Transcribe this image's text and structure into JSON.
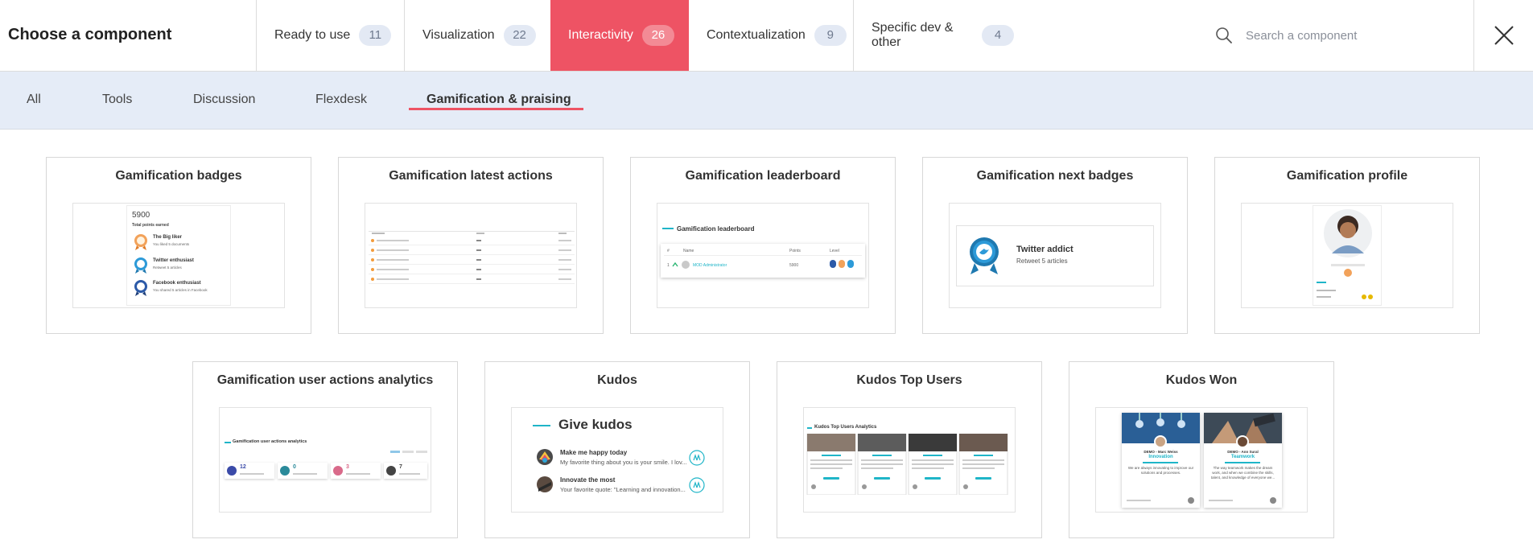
{
  "header": {
    "title": "Choose a component",
    "tabs": [
      {
        "label": "Ready to use",
        "count": "11"
      },
      {
        "label": "Visualization",
        "count": "22"
      },
      {
        "label": "Interactivity",
        "count": "26"
      },
      {
        "label": "Contextualization",
        "count": "9"
      },
      {
        "label": "Specific dev & other",
        "count": "4"
      }
    ],
    "search_placeholder": "Search a component"
  },
  "subnav": {
    "items": [
      "All",
      "Tools",
      "Discussion",
      "Flexdesk",
      "Gamification & praising"
    ]
  },
  "cards": [
    {
      "title": "Gamification badges"
    },
    {
      "title": "Gamification latest actions"
    },
    {
      "title": "Gamification leaderboard"
    },
    {
      "title": "Gamification next badges"
    },
    {
      "title": "Gamification profile"
    },
    {
      "title": "Gamification user actions analytics"
    },
    {
      "title": "Kudos"
    },
    {
      "title": "Kudos Top Users"
    },
    {
      "title": "Kudos Won"
    }
  ],
  "previews": {
    "badges": {
      "points": "5900",
      "points_label": "Total points earned",
      "items": [
        {
          "name": "The Big liker",
          "desc": "You liked 5 documents"
        },
        {
          "name": "Twitter enthusiast",
          "desc": "Retweet 5 articles"
        },
        {
          "name": "Facebook enthusiast",
          "desc": "You shared 5 articles in Facebook"
        }
      ]
    },
    "leaderboard": {
      "title": "Gamification leaderboard",
      "col_rank": "#",
      "col_name": "Name",
      "col_points": "Points",
      "col_level": "Level",
      "row_rank": "1",
      "row_name": "MOD Administrator",
      "row_points": "5900"
    },
    "next_badges": {
      "name": "Twitter addict",
      "desc": "Retweet 5 articles"
    },
    "analytics": {
      "title": "Gamification user actions analytics",
      "values": [
        "12",
        "0",
        "3",
        "7"
      ]
    },
    "kudos": {
      "title": "Give kudos",
      "items": [
        {
          "title": "Make me happy today",
          "desc": "My favorite thing about you is your smile. I lov..."
        },
        {
          "title": "Innovate the most",
          "desc": "Your favorite quote: \"Learning and innovation..."
        }
      ]
    },
    "top_users": {
      "title": "Kudos Top Users Analytics"
    },
    "kudos_won": {
      "cards": [
        {
          "name": "DEMO - Marc Weiss",
          "tag": "Innovation",
          "text": "We are always innovating to improve our solutions and processes."
        },
        {
          "name": "DEMO - Ann Sural",
          "tag": "Teamwork",
          "text": "The way teamwork makes the dream work, and when we combine the skills, talent, and knowledge of everyone we..."
        }
      ]
    }
  },
  "colors": {
    "accent": "#ee5364",
    "subnav_bg": "#e5ecf7",
    "badge_bg": "#e3e9f4",
    "teal": "#1fb5c8"
  }
}
